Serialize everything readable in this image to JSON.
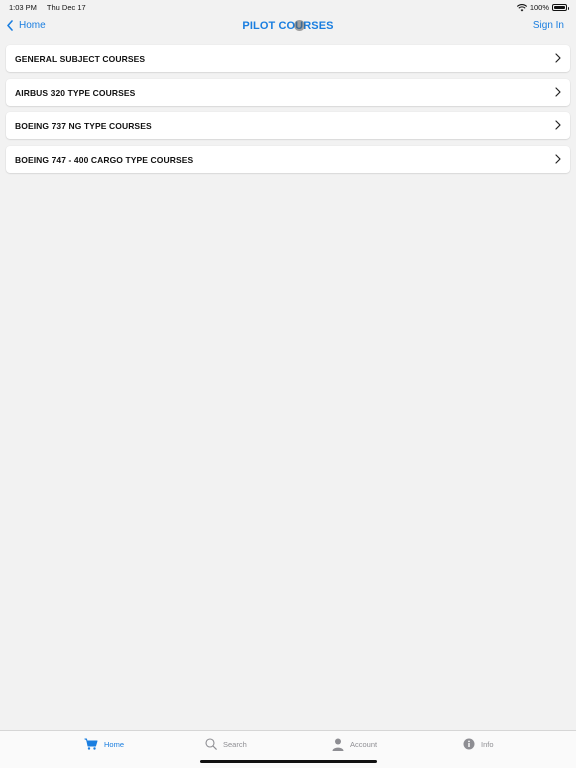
{
  "status_bar": {
    "time": "1:03 PM",
    "date": "Thu Dec 17",
    "battery": "100%"
  },
  "nav": {
    "back_label": "Home",
    "title": "PILOT COURSES",
    "sign_in_label": "Sign In"
  },
  "courses": [
    {
      "label": "GENERAL SUBJECT COURSES"
    },
    {
      "label": "AIRBUS 320 TYPE COURSES"
    },
    {
      "label": "BOEING 737 NG TYPE COURSES"
    },
    {
      "label": "BOEING 747 - 400 CARGO TYPE COURSES"
    }
  ],
  "tabs": [
    {
      "label": "Home",
      "icon": "cart-icon",
      "active": true
    },
    {
      "label": "Search",
      "icon": "search-icon",
      "active": false
    },
    {
      "label": "Account",
      "icon": "person-icon",
      "active": false
    },
    {
      "label": "Info",
      "icon": "info-icon",
      "active": false
    }
  ],
  "colors": {
    "accent": "#1a7ee0",
    "inactive": "#8e8e93",
    "background": "#f2f2f2"
  }
}
